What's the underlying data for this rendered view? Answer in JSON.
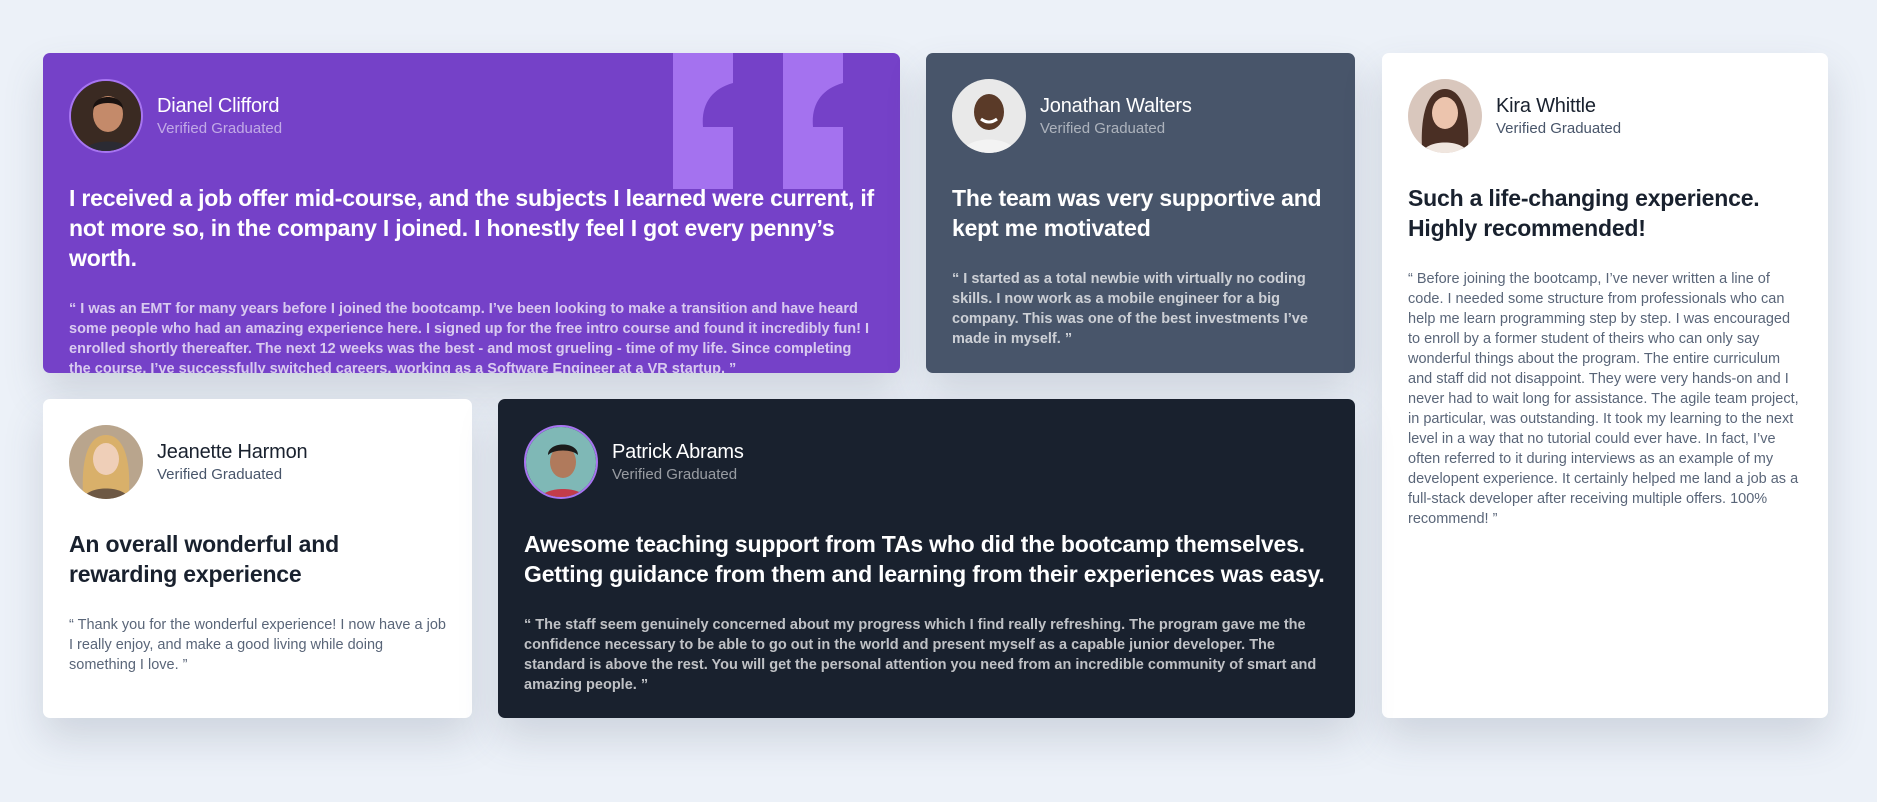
{
  "theme": {
    "page_bg": "#ecf1f8",
    "purple": "#7541c8",
    "grayish_blue": "#48556a",
    "very_dark": "#19212e",
    "white": "#ffffff",
    "quote_mark": "#a775f1"
  },
  "testimonials": [
    {
      "name": "Dianel Clifford",
      "status": "Verified Graduated",
      "headline": "I received a job offer mid-course, and the subjects I learned were current, if not more so, in the company I joined. I honestly feel I got every penny’s worth.",
      "body": "“ I was an EMT for many years before I joined the bootcamp. I’ve been looking to make a transition and have heard some people who had an amazing experience here. I signed up for the free intro course and found it incredibly fun! I enrolled shortly thereafter. The next 12 weeks was the best - and most grueling - time of my life. Since completing the course, I’ve successfully switched careers, working as a Software Engineer at a VR startup. ”",
      "avatar_icon": "avatar-man-dark-hair"
    },
    {
      "name": "Jonathan Walters",
      "status": "Verified Graduated",
      "headline": "The team was very supportive and kept me motivated",
      "body": "“ I started as a total newbie with virtually no coding skills. I now work as a mobile engineer for a big company. This was one of the best investments I’ve made in myself. ”",
      "avatar_icon": "avatar-man-smiling"
    },
    {
      "name": "Kira Whittle",
      "status": "Verified Graduated",
      "headline": "Such a life-changing experience. Highly recommended!",
      "body": "“ Before joining the bootcamp, I’ve never written a line of code. I needed some structure from professionals who can help me learn programming step by step. I was encouraged to enroll by a former student of theirs who can only say wonderful things about the program. The entire curriculum and staff did not disappoint. They were very hands-on and I never had to wait long for assistance. The agile team project, in particular, was outstanding. It took my learning to the next level in a way that no tutorial could ever have. In fact, I’ve often referred to it during interviews as an example of my developent experience. It certainly helped me land a job as a full-stack developer after receiving multiple offers. 100% recommend! ”",
      "avatar_icon": "avatar-woman-dark-hair"
    },
    {
      "name": "Jeanette Harmon",
      "status": "Verified Graduated",
      "headline": "An overall wonderful and rewarding experience",
      "body": "“ Thank you for the wonderful experience! I now have a job I really enjoy, and make a good living while doing something I love. ”",
      "avatar_icon": "avatar-woman-blonde"
    },
    {
      "name": "Patrick Abrams",
      "status": "Verified Graduated",
      "headline": "Awesome teaching support from TAs who did the bootcamp themselves. Getting guidance from them and learning from their experiences was easy.",
      "body": "“ The staff seem genuinely concerned about my progress which I find really refreshing. The program gave me the confidence necessary to be able to go out in the world and present myself as a capable junior developer. The standard is above the rest. You will get the personal attention you need from an incredible community of smart and amazing people. ”",
      "avatar_icon": "avatar-man-cap"
    }
  ]
}
